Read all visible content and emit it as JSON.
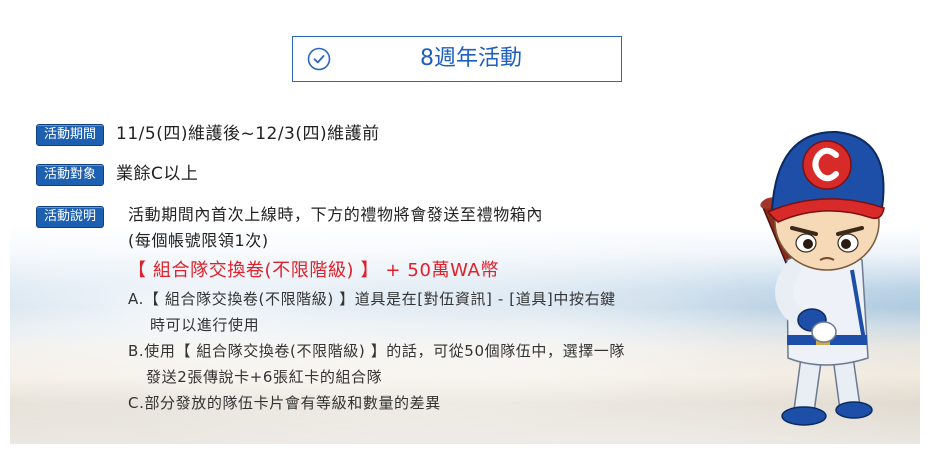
{
  "header": {
    "title": "8週年活動",
    "icon": "check-circle-icon",
    "accent": "#1f5fbf"
  },
  "event": {
    "period": {
      "label": "活動期間",
      "value": "11/5(四)維護後~12/3(四)維護前"
    },
    "target": {
      "label": "活動對象",
      "value": "業餘C以上"
    },
    "description": {
      "label": "活動說明",
      "lines": [
        "活動期間內首次上線時，下方的禮物將會發送至禮物箱內",
        "(每個帳號限領1次)"
      ],
      "reward": "【 組合隊交換卷(不限階級) 】 + 50萬WA幣",
      "notes": [
        "A.【 組合隊交換卷(不限階級) 】道具是在[對伍資訊] - [道具]中按右鍵",
        "時可以進行使用",
        "B.使用【 組合隊交換卷(不限階級) 】的話，可從50個隊伍中，選擇一隊",
        "發送2張傳說卡+6張紅卡的組合隊",
        "C.部分發放的隊伍卡片會有等級和數量的差異"
      ]
    }
  },
  "colors": {
    "tag_bg": "#1d5fb0",
    "reward": "#e0202a",
    "mascot_cap": "#1d4fa8",
    "mascot_letter": "#e02a2a"
  }
}
